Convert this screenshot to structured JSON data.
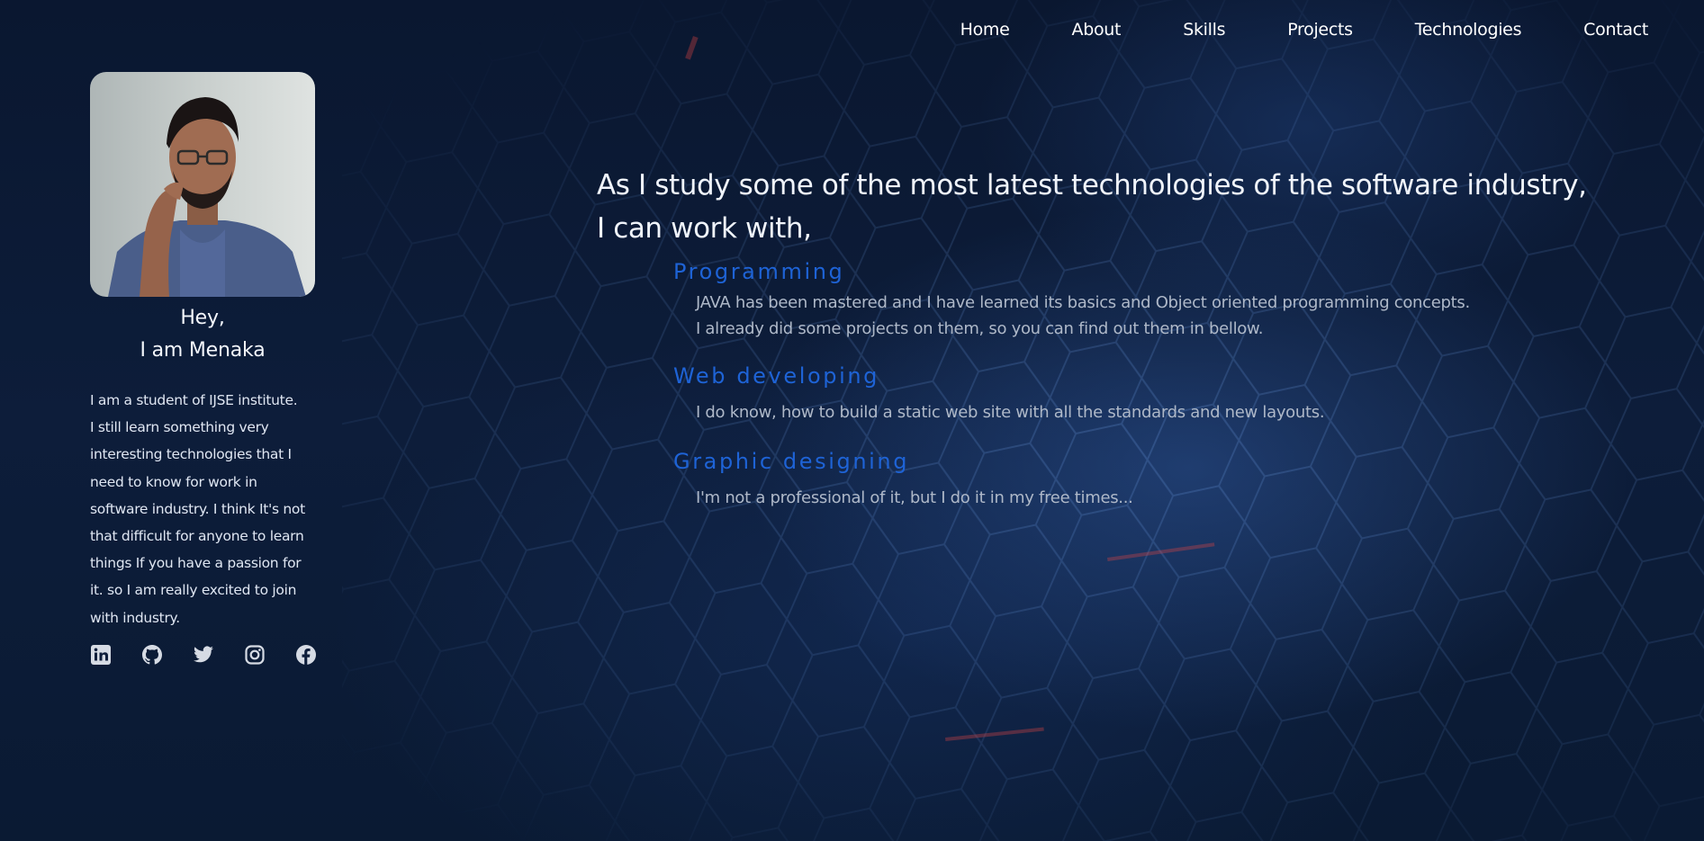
{
  "nav": {
    "items": [
      "Home",
      "About",
      "Skills",
      "Projects",
      "Technologies",
      "Contact"
    ]
  },
  "profile": {
    "greeting_line1": "Hey,",
    "greeting_line2": "I am Menaka",
    "bio_line1": "I am a student of IJSE institute.",
    "bio_line2": "I still learn something very interesting technologies that I need to know for work in software industry. I think It's not that difficult for anyone to learn things If you have a passion for it. so I am really excited to join with industry."
  },
  "socials": [
    "linkedin-icon",
    "github-icon",
    "twitter-icon",
    "instagram-icon",
    "facebook-icon"
  ],
  "main": {
    "intro_line1": "As I study some of the most latest technologies of the software industry,",
    "intro_line2": "I can work with,",
    "sections": [
      {
        "title": "Programming",
        "lines": [
          "JAVA has been mastered and I have learned its basics and Object oriented programming concepts.",
          "I already did some projects on them, so you can find out them in bellow."
        ]
      },
      {
        "title": "Web developing",
        "lines": [
          "I do know, how to build a static web site with all the standards and new layouts."
        ]
      },
      {
        "title": "Graphic designing",
        "lines": [
          "I'm not a professional of it, but I do it in my free times..."
        ]
      }
    ]
  },
  "colors": {
    "background": "#0b1a33",
    "accent": "#1e63d6",
    "text": "#ffffff",
    "muted_text": "#aeb8c8"
  }
}
